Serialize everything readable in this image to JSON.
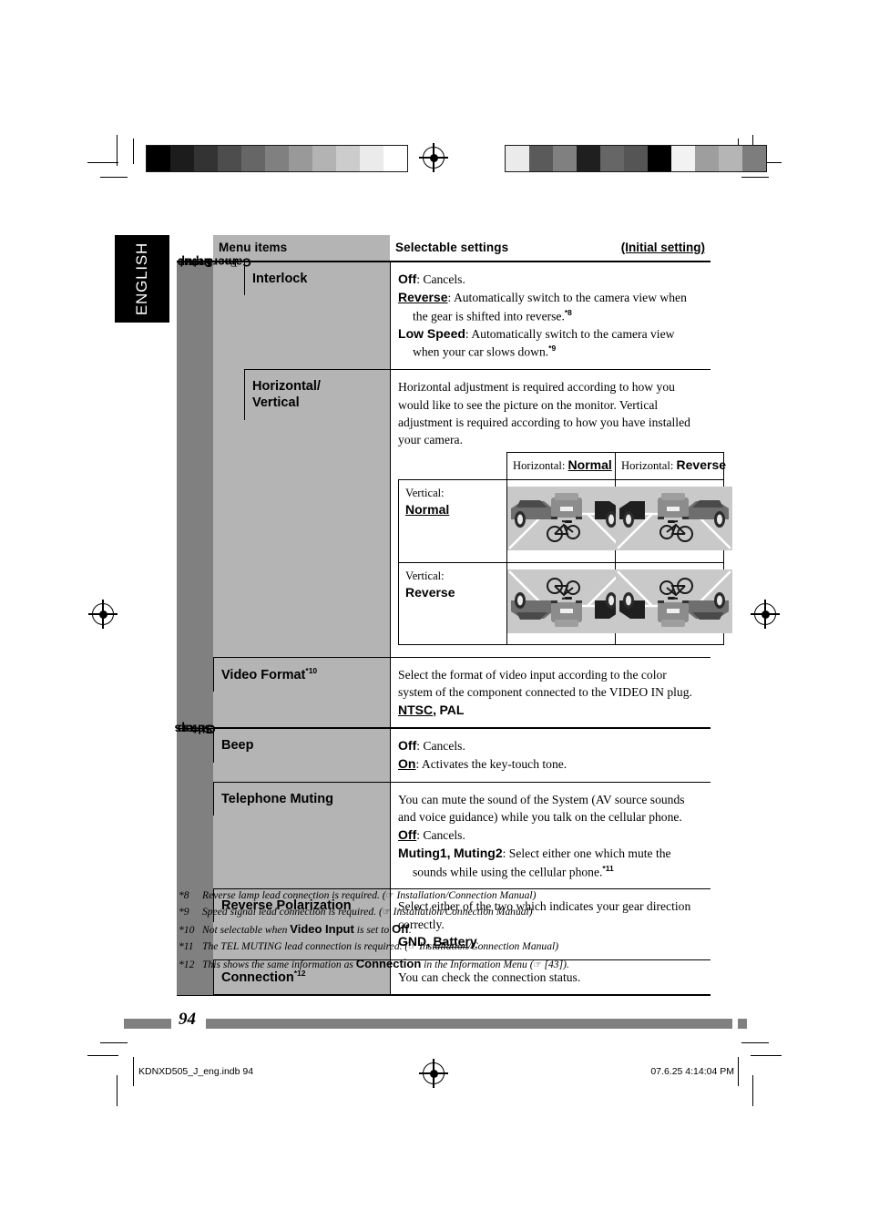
{
  "page": {
    "language_tab": "ENGLISH",
    "page_number": "94",
    "imprint_left": "KDNXD505_J_eng.indb   94",
    "imprint_right": "07.6.25   4:14:04 PM"
  },
  "table": {
    "header": {
      "menu_items": "Menu items",
      "selectable_settings": "Selectable settings",
      "initial_setting": "(Initial setting)"
    },
    "groups": [
      {
        "label_prefix": "Setup",
        "arrow": "⇨",
        "label": "Input",
        "sub_label_lite": "For ",
        "sub_label_bold": "Camera"
      },
      {
        "label_prefix": "Setup",
        "arrow": "⇨",
        "label": "Others"
      }
    ],
    "rows": [
      {
        "menu": "Interlock",
        "options": [
          {
            "name": "Off",
            "underline": false,
            "text": ": Cancels."
          },
          {
            "name": "Reverse",
            "underline": true,
            "text": ": Automatically switch to the camera view when",
            "cont": "the gear is shifted into reverse.",
            "sup": "*8"
          },
          {
            "name": "Low Speed",
            "underline": false,
            "text": ": Automatically switch to the camera view",
            "cont": "when your car slows down.",
            "sup": "*9"
          }
        ]
      },
      {
        "menu_line1": "Horizontal/",
        "menu_line2": "Vertical",
        "paragraph": "Horizontal adjustment is required according to how you would like to see the picture on the monitor. Vertical adjustment is required according to how you have installed your camera.",
        "matrix": {
          "col_headers": [
            {
              "prefix": "Horizontal: ",
              "value": "Normal",
              "underline": true
            },
            {
              "prefix": "Horizontal: ",
              "value": "Reverse",
              "underline": false
            }
          ],
          "row_headers": [
            {
              "prefix": "Vertical:",
              "value": "Normal",
              "underline": true
            },
            {
              "prefix": "Vertical:",
              "value": "Reverse",
              "underline": false
            }
          ],
          "cells": [
            [
              "h-normal-v-normal",
              "h-reverse-v-normal"
            ],
            [
              "h-normal-v-reverse",
              "h-reverse-v-reverse"
            ]
          ]
        }
      },
      {
        "menu": "Video Format",
        "menu_sup": "*10",
        "paragraph": "Select the format of video input according to the color system of the component connected to the VIDEO IN plug.",
        "value_list": [
          {
            "name": "NTSC",
            "underline": true
          },
          {
            "name": "PAL",
            "underline": false
          }
        ]
      },
      {
        "menu": "Beep",
        "options": [
          {
            "name": "Off",
            "underline": false,
            "text": ": Cancels."
          },
          {
            "name": "On",
            "underline": true,
            "text": ": Activates the key-touch tone."
          }
        ]
      },
      {
        "menu": "Telephone Muting",
        "paragraph": "You can mute the sound of the System (AV source sounds and voice guidance) while you talk on the cellular phone.",
        "options": [
          {
            "name": "Off",
            "underline": true,
            "text": ": Cancels."
          },
          {
            "name": "Muting1",
            "name2": "Muting2",
            "underline": false,
            "text": ": Select either one which mute the",
            "cont": "sounds while using the cellular phone.",
            "sup": "*11"
          }
        ]
      },
      {
        "menu": "Reverse Polarization",
        "paragraph": "Select either of the two which indicates your gear direction correctly.",
        "value_list": [
          {
            "name": "GND",
            "underline": false
          },
          {
            "name": "Battery",
            "underline": true
          }
        ]
      },
      {
        "menu": "Connection",
        "menu_sup": "*12",
        "paragraph": "You can check the connection status."
      }
    ]
  },
  "footnotes": [
    {
      "num": "*8",
      "text_before": "Reverse lamp lead connection is required. (",
      "hand": "☞",
      "text_after": " Installation/Connection Manual)"
    },
    {
      "num": "*9",
      "text_before": "Speed signal lead connection is required. (",
      "hand": "☞",
      "text_after": " Installation/Connection Manual)"
    },
    {
      "num": "*10",
      "text_before": "Not selectable when ",
      "bold": "Video Input",
      "text_mid": " is set to ",
      "bold2": "Off",
      "text_after": "."
    },
    {
      "num": "*11",
      "text_before": "The TEL MUTING lead connection is required. (",
      "hand": "☞",
      "text_after": " Installation/Connection Manual)"
    },
    {
      "num": "*12",
      "text_before": "This shows the same information as ",
      "bold": "Connection",
      "text_mid": " in the Information Menu (",
      "hand": "☞",
      "text_after": " [43])."
    }
  ],
  "colors": {
    "group_gray": "#808080",
    "menu_gray": "#b4b4b4",
    "scene_road": "#c9c9c9",
    "scene_sky": "#b0b0b0"
  },
  "colorbars": {
    "left": [
      "#000000",
      "#1c1c1c",
      "#333333",
      "#4d4d4d",
      "#666666",
      "#808080",
      "#999999",
      "#b3b3b3",
      "#cccccc",
      "#ebebeb",
      "#ffffff"
    ],
    "right": [
      "#ebebeb",
      "#5a5a5a",
      "#808080",
      "#1f1f1f",
      "#666666",
      "#555555",
      "#000000",
      "#f2f2f2",
      "#9e9e9e",
      "#b5b5b5",
      "#7d7d7d"
    ]
  }
}
